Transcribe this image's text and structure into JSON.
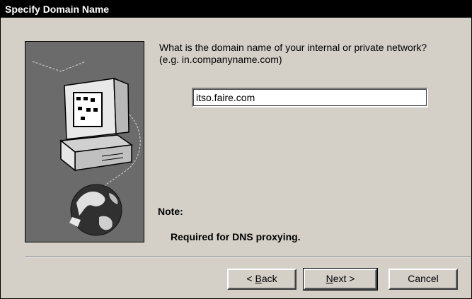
{
  "window": {
    "title": "Specify Domain Name"
  },
  "prompt": {
    "line1": "What is the domain name of your internal or private network?",
    "line2": "(e.g. in.companyname.com)"
  },
  "domain_input": {
    "value": "itso.faire.com"
  },
  "note": {
    "label": "Note:",
    "text": "Required for DNS proxying."
  },
  "buttons": {
    "back_mnemonic": "B",
    "back_rest": "ack",
    "back_prefix": "< ",
    "next_mnemonic": "N",
    "next_rest": "ext >",
    "cancel": "Cancel"
  },
  "colors": {
    "titlebar": "#000000",
    "dialog_bg": "#d4d0c8",
    "image_bg": "#6b6b6b"
  }
}
